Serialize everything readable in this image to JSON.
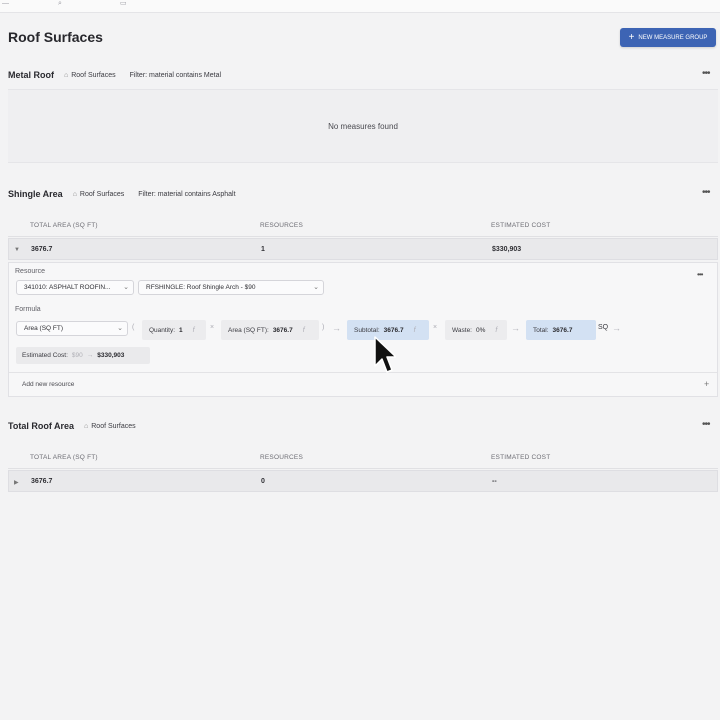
{
  "page": {
    "title": "Roof Surfaces",
    "new_group_button": "NEW MEASURE GROUP"
  },
  "groups": [
    {
      "name": "Metal Roof",
      "scope": "Roof Surfaces",
      "filter": "Filter: material contains Metal",
      "empty_text": "No measures found"
    },
    {
      "name": "Shingle Area",
      "scope": "Roof Surfaces",
      "filter": "Filter: material contains Asphalt",
      "columns": [
        "TOTAL AREA (SQ FT)",
        "RESOURCES",
        "ESTIMATED COST"
      ],
      "row": {
        "area": "3676.7",
        "resources": "1",
        "cost": "$330,903"
      },
      "detail": {
        "resource_label": "Resource",
        "resource_select": "341010: ASPHALT ROOFIN...",
        "item_select": "RFSHINGLE: Roof Shingle Arch - $90",
        "formula_label": "Formula",
        "formula_select": "Area (SQ FT)",
        "quantity_label": "Quantity:",
        "quantity_value": "1",
        "area_label": "Area (SQ FT):",
        "area_value": "3676.7",
        "subtotal_label": "Subtotal:",
        "subtotal_value": "3676.7",
        "waste_label": "Waste:",
        "waste_value": "0%",
        "total_label": "Total:",
        "total_value": "3676.7",
        "unit": "SQ",
        "estimated_label": "Estimated Cost:",
        "estimated_old": "$90",
        "estimated_new": "$330,903",
        "add_resource": "Add new resource"
      }
    },
    {
      "name": "Total Roof Area",
      "scope": "Roof Surfaces",
      "columns": [
        "TOTAL AREA (SQ FT)",
        "RESOURCES",
        "ESTIMATED COST"
      ],
      "row": {
        "area": "3676.7",
        "resources": "0",
        "cost": "--"
      }
    }
  ],
  "colors": {
    "primary": "#3d64b4",
    "highlight": "#d3e1f3",
    "background": "#f3f3f4"
  }
}
